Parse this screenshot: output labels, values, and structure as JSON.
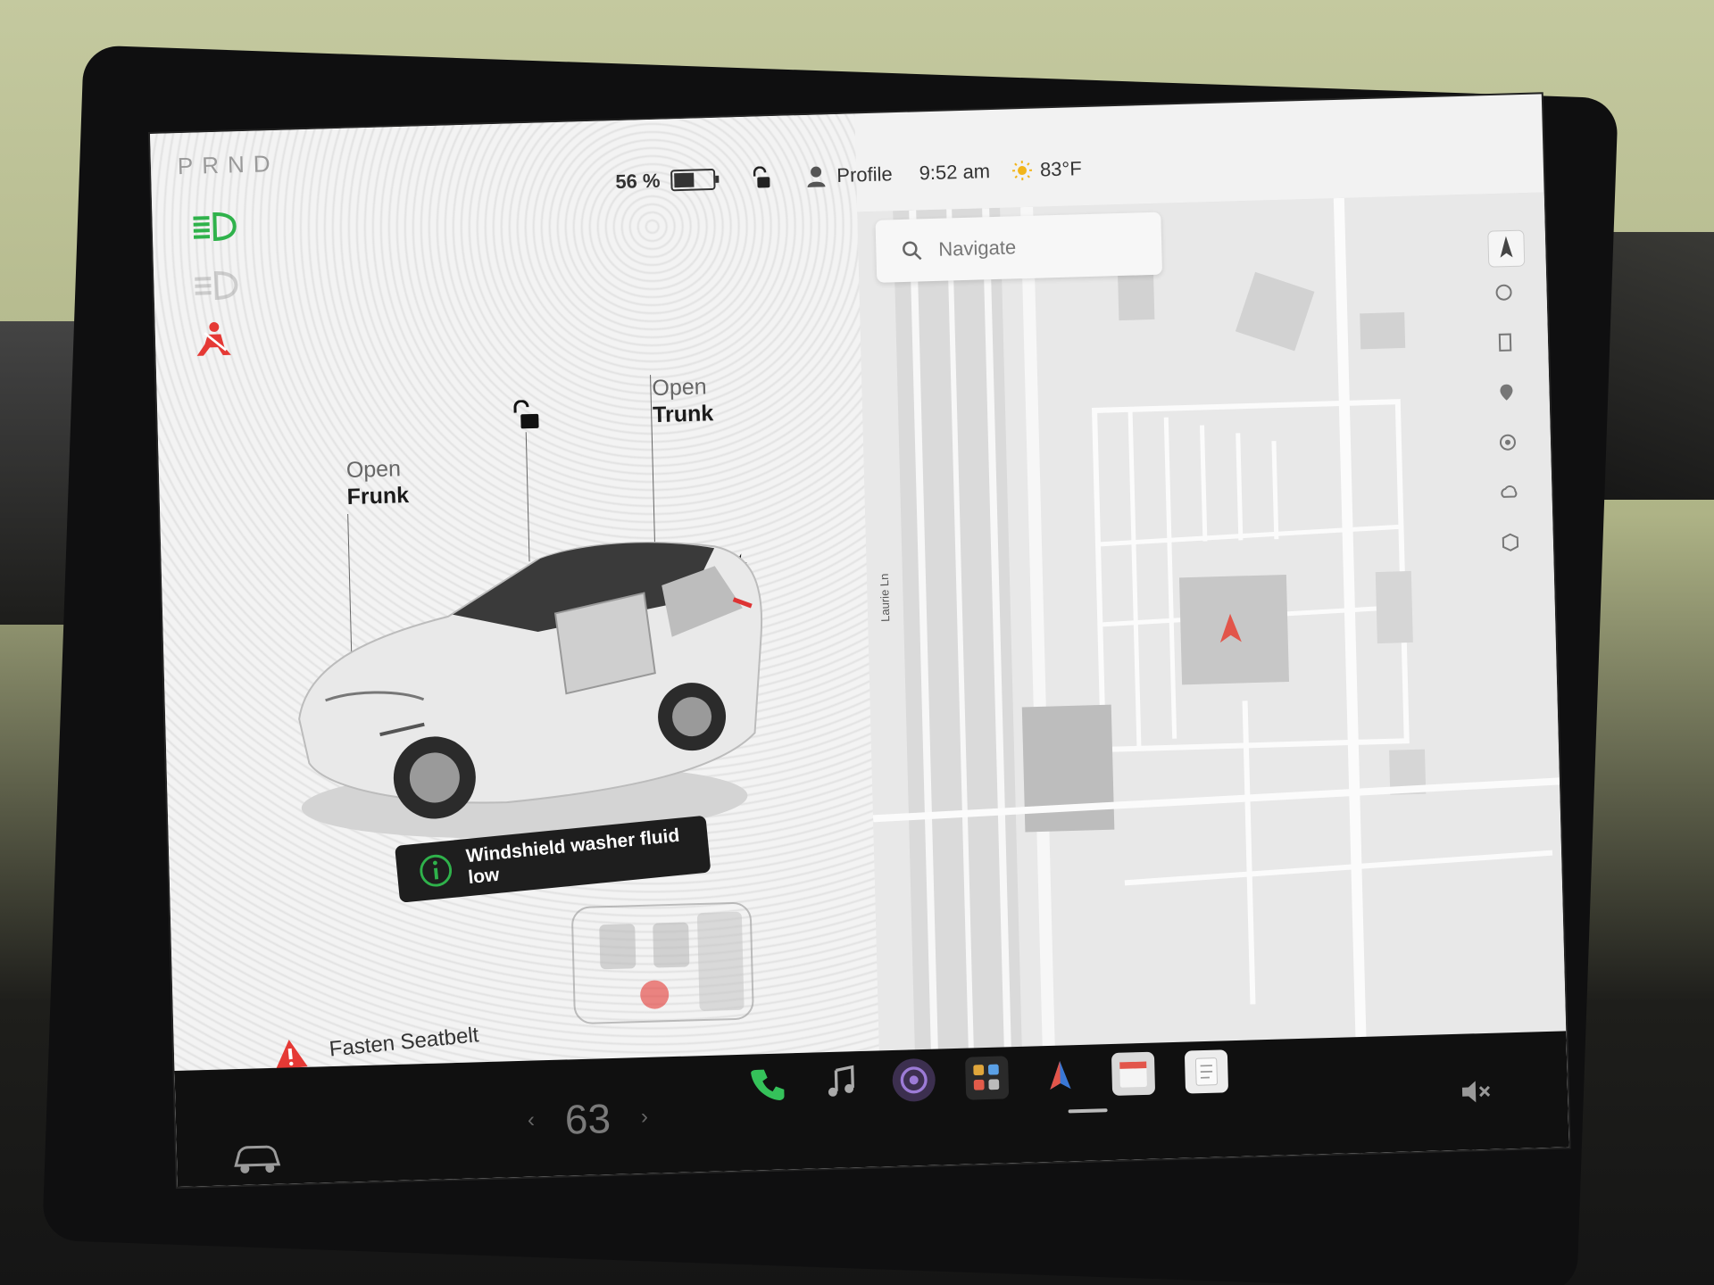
{
  "gear": {
    "letters": [
      "P",
      "R",
      "N",
      "D"
    ],
    "active": "P"
  },
  "status_bar": {
    "battery_percent": "56 %",
    "battery_level": 0.56,
    "profile_label": "Profile",
    "time": "9:52 am",
    "temperature": "83°F"
  },
  "car_controls": {
    "frunk": {
      "small": "Open",
      "big": "Frunk"
    },
    "trunk": {
      "small": "Open",
      "big": "Trunk"
    }
  },
  "toast": {
    "message": "Windshield washer fluid low"
  },
  "alert": {
    "message": "Fasten Seatbelt"
  },
  "map": {
    "search_placeholder": "Navigate",
    "street_label": "Laurie Ln"
  },
  "dock": {
    "cabin_temperature": "63",
    "apps": [
      "phone",
      "music",
      "camera",
      "launcher",
      "navigation",
      "calendar",
      "notes"
    ]
  },
  "colors": {
    "lights_green": "#2fb24b",
    "warning_red": "#e53935",
    "phone_green": "#35c25a",
    "nav_marker_red": "#e2554a"
  }
}
